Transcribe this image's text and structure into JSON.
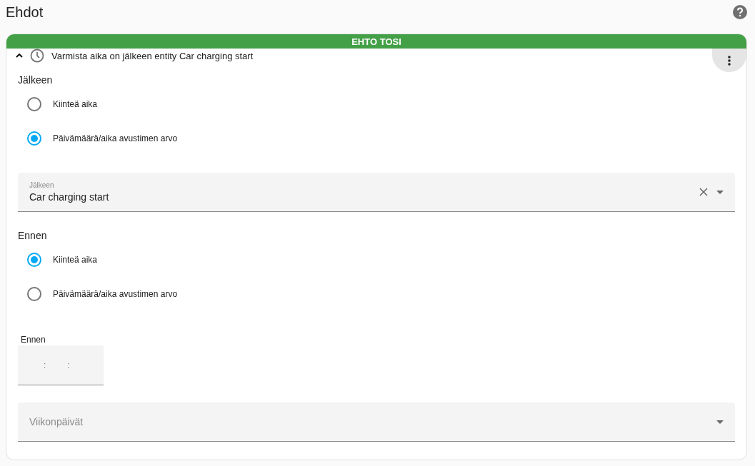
{
  "page": {
    "title": "Ehdot"
  },
  "condition": {
    "status": "EHTO TOSI",
    "passed": true,
    "expanded": true,
    "title": "Varmista aika on jälkeen entity Car charging start",
    "after": {
      "label": "Jälkeen",
      "options": [
        {
          "label": "Kiinteä aika",
          "selected": false
        },
        {
          "label": "Päivämäärä/aika avustimen arvo",
          "selected": true
        }
      ],
      "entity_field": {
        "label": "Jälkeen",
        "value": "Car charging start"
      }
    },
    "before": {
      "label": "Ennen",
      "options": [
        {
          "label": "Kiinteä aika",
          "selected": true
        },
        {
          "label": "Päivämäärä/aika avustimen arvo",
          "selected": false
        }
      ],
      "time_field": {
        "label": "Ennen",
        "separators": [
          ":",
          ":"
        ]
      }
    },
    "weekdays": {
      "placeholder": "Viikonpäivät"
    }
  }
}
